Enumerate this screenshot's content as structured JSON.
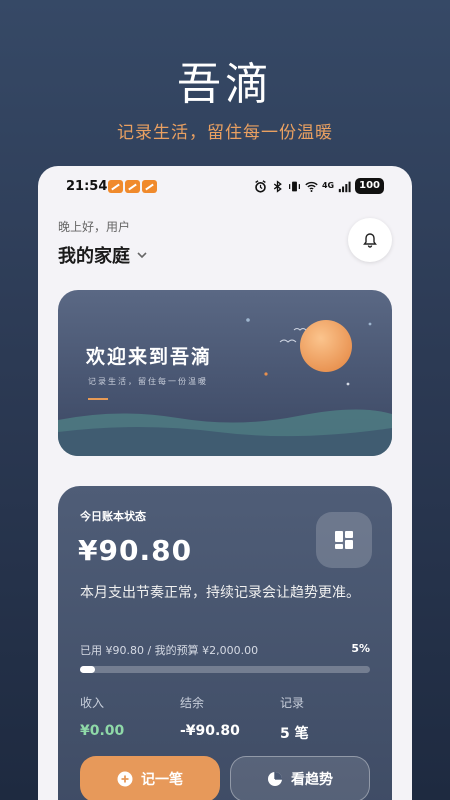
{
  "hero": {
    "title": "吾滴",
    "subtitle": "记录生活，留住每一份温暖"
  },
  "status_bar": {
    "time": "21:54",
    "network": "4G",
    "battery": "100",
    "icons": [
      "alarm-icon",
      "bluetooth-icon",
      "vibrate-icon",
      "wifi-icon",
      "signal-icon"
    ]
  },
  "header": {
    "greeting": "晚上好，用户",
    "family": "我的家庭"
  },
  "banner": {
    "title": "欢迎来到吾滴",
    "subtitle": "记录生活，留住每一份温暖"
  },
  "account": {
    "label": "今日账本状态",
    "amount": "¥90.80",
    "description": "本月支出节奏正常，持续记录会让趋势更准。",
    "used_text": "已用 ¥90.80 / 我的预算 ¥2,000.00",
    "percent_text": "5%",
    "progress_fraction": 0.05,
    "stats": {
      "income_label": "收入",
      "income_value": "¥0.00",
      "balance_label": "结余",
      "balance_value": "-¥90.80",
      "records_label": "记录",
      "records_value": "5 笔"
    },
    "buttons": {
      "add": "记一笔",
      "trend": "看趋势"
    }
  },
  "colors": {
    "accent": "#e7995a",
    "income_green": "#8fd9a8",
    "subtitle_orange": "#e9a061"
  }
}
